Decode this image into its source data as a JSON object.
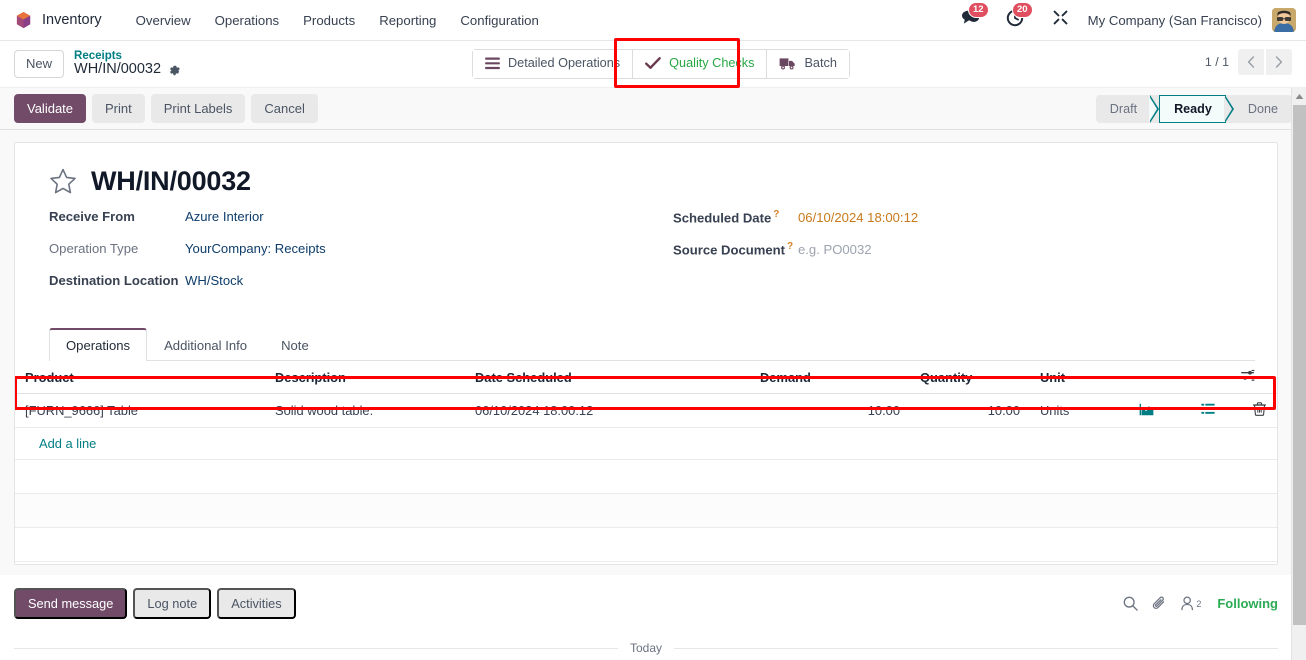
{
  "navbar": {
    "app_name": "Inventory",
    "menus": [
      "Overview",
      "Operations",
      "Products",
      "Reporting",
      "Configuration"
    ],
    "messages_badge": "12",
    "activities_badge": "20",
    "company": "My Company (San Francisco)"
  },
  "control_panel": {
    "new_label": "New",
    "breadcrumb_parent": "Receipts",
    "breadcrumb_current": "WH/IN/00032",
    "buttons": [
      {
        "label": "Detailed Operations",
        "icon": "list-icon",
        "highlighted": false
      },
      {
        "label": "Quality Checks",
        "icon": "check-icon",
        "highlighted": true
      },
      {
        "label": "Batch",
        "icon": "truck-icon",
        "highlighted": false
      }
    ],
    "pager": "1 / 1"
  },
  "actions": {
    "primary": "Validate",
    "secondary": [
      "Print",
      "Print Labels",
      "Cancel"
    ]
  },
  "statusbar": {
    "states": [
      "Draft",
      "Ready",
      "Done"
    ],
    "active": "Ready"
  },
  "record": {
    "title": "WH/IN/00032",
    "left_fields": [
      {
        "label": "Receive From",
        "value": "Azure Interior",
        "style": "link",
        "bold": true,
        "tip": false
      },
      {
        "label": "Operation Type",
        "value": "YourCompany: Receipts",
        "style": "link",
        "bold": false,
        "tip": false
      },
      {
        "label": "Destination Location",
        "value": "WH/Stock",
        "style": "link",
        "bold": true,
        "tip": false
      }
    ],
    "right_fields": [
      {
        "label": "Scheduled Date",
        "value": "06/10/2024 18:00:12",
        "style": "warn",
        "bold": true,
        "tip": true
      },
      {
        "label": "Source Document",
        "value": "e.g. PO0032",
        "style": "placeholder",
        "bold": true,
        "tip": true
      }
    ]
  },
  "notebook": {
    "tabs": [
      {
        "label": "Operations",
        "active": true
      },
      {
        "label": "Additional Info",
        "active": false
      },
      {
        "label": "Note",
        "active": false
      }
    ]
  },
  "table": {
    "columns": [
      "Product",
      "Description",
      "Date Scheduled",
      "Demand",
      "Quantity",
      "Unit"
    ],
    "rows": [
      {
        "product": "[FURN_9666] Table",
        "description": "Solid wood table.",
        "date_scheduled": "06/10/2024 18:00:12",
        "demand": "10.00",
        "quantity": "10.00",
        "unit": "Units",
        "highlighted": true
      }
    ],
    "add_line_label": "Add a line"
  },
  "chatter": {
    "send_message": "Send message",
    "log_note": "Log note",
    "activities": "Activities",
    "follower_count": "2",
    "following_label": "Following",
    "today_label": "Today"
  },
  "colors": {
    "primary": "#714b67",
    "accent_teal": "#017e84",
    "success_green": "#28a745",
    "following_green": "#2bab53",
    "warning_orange": "#c87a1a",
    "badge_red": "#e04f5f",
    "highlight_red": "#ff0000"
  }
}
